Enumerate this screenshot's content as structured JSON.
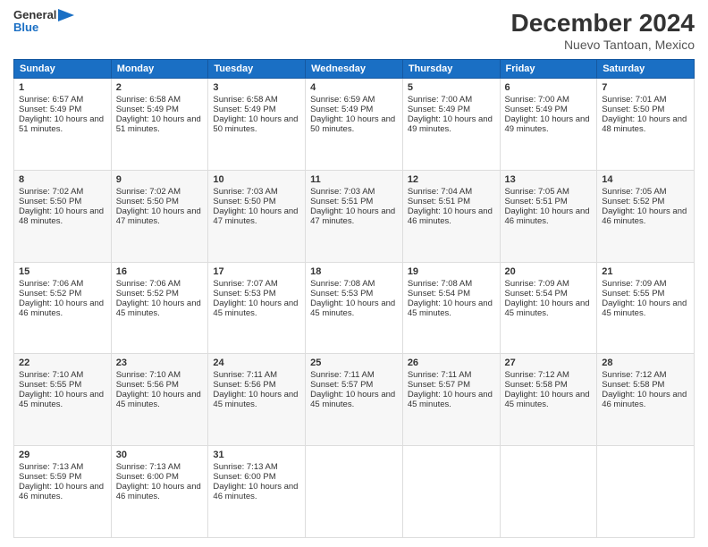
{
  "header": {
    "logo_general": "General",
    "logo_blue": "Blue",
    "title": "December 2024",
    "subtitle": "Nuevo Tantoan, Mexico"
  },
  "calendar": {
    "headers": [
      "Sunday",
      "Monday",
      "Tuesday",
      "Wednesday",
      "Thursday",
      "Friday",
      "Saturday"
    ],
    "weeks": [
      [
        null,
        null,
        null,
        null,
        {
          "day": "5",
          "sunrise": "Sunrise: 7:00 AM",
          "sunset": "Sunset: 5:49 PM",
          "daylight": "Daylight: 10 hours and 49 minutes."
        },
        {
          "day": "6",
          "sunrise": "Sunrise: 7:00 AM",
          "sunset": "Sunset: 5:49 PM",
          "daylight": "Daylight: 10 hours and 49 minutes."
        },
        {
          "day": "7",
          "sunrise": "Sunrise: 7:01 AM",
          "sunset": "Sunset: 5:50 PM",
          "daylight": "Daylight: 10 hours and 48 minutes."
        }
      ],
      [
        {
          "day": "1",
          "sunrise": "Sunrise: 6:57 AM",
          "sunset": "Sunset: 5:49 PM",
          "daylight": "Daylight: 10 hours and 51 minutes."
        },
        {
          "day": "2",
          "sunrise": "Sunrise: 6:58 AM",
          "sunset": "Sunset: 5:49 PM",
          "daylight": "Daylight: 10 hours and 51 minutes."
        },
        {
          "day": "3",
          "sunrise": "Sunrise: 6:58 AM",
          "sunset": "Sunset: 5:49 PM",
          "daylight": "Daylight: 10 hours and 50 minutes."
        },
        {
          "day": "4",
          "sunrise": "Sunrise: 6:59 AM",
          "sunset": "Sunset: 5:49 PM",
          "daylight": "Daylight: 10 hours and 50 minutes."
        },
        {
          "day": "8",
          "sunrise": "Sunrise: 7:02 AM",
          "sunset": "Sunset: 5:50 PM",
          "daylight": "Daylight: 10 hours and 48 minutes."
        },
        {
          "day": "9",
          "sunrise": "Sunrise: 7:02 AM",
          "sunset": "Sunset: 5:50 PM",
          "daylight": "Daylight: 10 hours and 47 minutes."
        },
        {
          "day": "10",
          "sunrise": "Sunrise: 7:03 AM",
          "sunset": "Sunset: 5:50 PM",
          "daylight": "Daylight: 10 hours and 47 minutes."
        }
      ],
      [
        {
          "day": "8",
          "sunrise": "Sunrise: 7:02 AM",
          "sunset": "Sunset: 5:50 PM",
          "daylight": "Daylight: 10 hours and 48 minutes."
        },
        {
          "day": "9",
          "sunrise": "Sunrise: 7:02 AM",
          "sunset": "Sunset: 5:50 PM",
          "daylight": "Daylight: 10 hours and 47 minutes."
        },
        {
          "day": "10",
          "sunrise": "Sunrise: 7:03 AM",
          "sunset": "Sunset: 5:50 PM",
          "daylight": "Daylight: 10 hours and 47 minutes."
        },
        {
          "day": "11",
          "sunrise": "Sunrise: 7:03 AM",
          "sunset": "Sunset: 5:51 PM",
          "daylight": "Daylight: 10 hours and 47 minutes."
        },
        {
          "day": "12",
          "sunrise": "Sunrise: 7:04 AM",
          "sunset": "Sunset: 5:51 PM",
          "daylight": "Daylight: 10 hours and 46 minutes."
        },
        {
          "day": "13",
          "sunrise": "Sunrise: 7:05 AM",
          "sunset": "Sunset: 5:51 PM",
          "daylight": "Daylight: 10 hours and 46 minutes."
        },
        {
          "day": "14",
          "sunrise": "Sunrise: 7:05 AM",
          "sunset": "Sunset: 5:52 PM",
          "daylight": "Daylight: 10 hours and 46 minutes."
        }
      ],
      [
        {
          "day": "15",
          "sunrise": "Sunrise: 7:06 AM",
          "sunset": "Sunset: 5:52 PM",
          "daylight": "Daylight: 10 hours and 46 minutes."
        },
        {
          "day": "16",
          "sunrise": "Sunrise: 7:06 AM",
          "sunset": "Sunset: 5:52 PM",
          "daylight": "Daylight: 10 hours and 45 minutes."
        },
        {
          "day": "17",
          "sunrise": "Sunrise: 7:07 AM",
          "sunset": "Sunset: 5:53 PM",
          "daylight": "Daylight: 10 hours and 45 minutes."
        },
        {
          "day": "18",
          "sunrise": "Sunrise: 7:08 AM",
          "sunset": "Sunset: 5:53 PM",
          "daylight": "Daylight: 10 hours and 45 minutes."
        },
        {
          "day": "19",
          "sunrise": "Sunrise: 7:08 AM",
          "sunset": "Sunset: 5:54 PM",
          "daylight": "Daylight: 10 hours and 45 minutes."
        },
        {
          "day": "20",
          "sunrise": "Sunrise: 7:09 AM",
          "sunset": "Sunset: 5:54 PM",
          "daylight": "Daylight: 10 hours and 45 minutes."
        },
        {
          "day": "21",
          "sunrise": "Sunrise: 7:09 AM",
          "sunset": "Sunset: 5:55 PM",
          "daylight": "Daylight: 10 hours and 45 minutes."
        }
      ],
      [
        {
          "day": "22",
          "sunrise": "Sunrise: 7:10 AM",
          "sunset": "Sunset: 5:55 PM",
          "daylight": "Daylight: 10 hours and 45 minutes."
        },
        {
          "day": "23",
          "sunrise": "Sunrise: 7:10 AM",
          "sunset": "Sunset: 5:56 PM",
          "daylight": "Daylight: 10 hours and 45 minutes."
        },
        {
          "day": "24",
          "sunrise": "Sunrise: 7:11 AM",
          "sunset": "Sunset: 5:56 PM",
          "daylight": "Daylight: 10 hours and 45 minutes."
        },
        {
          "day": "25",
          "sunrise": "Sunrise: 7:11 AM",
          "sunset": "Sunset: 5:57 PM",
          "daylight": "Daylight: 10 hours and 45 minutes."
        },
        {
          "day": "26",
          "sunrise": "Sunrise: 7:11 AM",
          "sunset": "Sunset: 5:57 PM",
          "daylight": "Daylight: 10 hours and 45 minutes."
        },
        {
          "day": "27",
          "sunrise": "Sunrise: 7:12 AM",
          "sunset": "Sunset: 5:58 PM",
          "daylight": "Daylight: 10 hours and 45 minutes."
        },
        {
          "day": "28",
          "sunrise": "Sunrise: 7:12 AM",
          "sunset": "Sunset: 5:58 PM",
          "daylight": "Daylight: 10 hours and 46 minutes."
        }
      ],
      [
        {
          "day": "29",
          "sunrise": "Sunrise: 7:13 AM",
          "sunset": "Sunset: 5:59 PM",
          "daylight": "Daylight: 10 hours and 46 minutes."
        },
        {
          "day": "30",
          "sunrise": "Sunrise: 7:13 AM",
          "sunset": "Sunset: 6:00 PM",
          "daylight": "Daylight: 10 hours and 46 minutes."
        },
        {
          "day": "31",
          "sunrise": "Sunrise: 7:13 AM",
          "sunset": "Sunset: 6:00 PM",
          "daylight": "Daylight: 10 hours and 46 minutes."
        },
        null,
        null,
        null,
        null
      ]
    ]
  }
}
